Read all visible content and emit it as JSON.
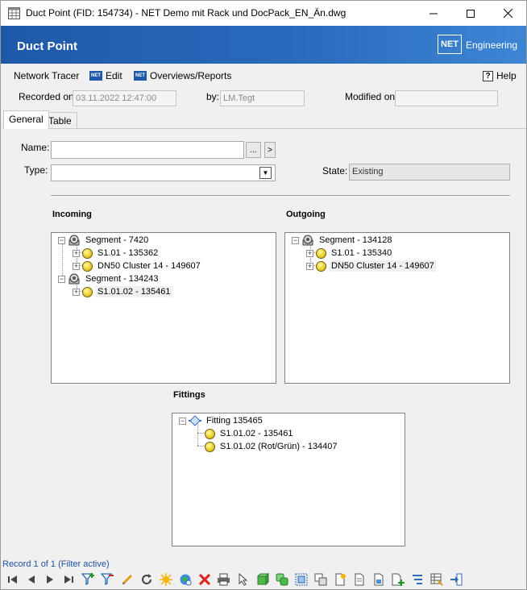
{
  "window": {
    "title": "Duct Point (FID: 154734) - NET Demo mit Rack und DocPack_EN_Än.dwg"
  },
  "banner": {
    "title": "Duct Point",
    "logo_text": "NET",
    "brand_text": "Engineering"
  },
  "menu": {
    "network_tracer": "Network Tracer",
    "edit": "Edit",
    "overviews": "Overviews/Reports",
    "help": "Help",
    "help_glyph": "?",
    "net_badge": "NET"
  },
  "record": {
    "recorded_on_label": "Recorded on:",
    "recorded_on_value": "03.11.2022 12:47:00",
    "by_label": "by:",
    "by_value": "LM.Tegt",
    "modified_on_label": "Modified on:",
    "modified_on_value": ""
  },
  "tabs": {
    "general": "General",
    "table": "Table"
  },
  "form": {
    "name_label": "Name:",
    "name_value": "",
    "ellipsis_button": "...",
    "arrow_button": ">",
    "type_label": "Type:",
    "type_value": "",
    "dropdown_glyph": "▼",
    "state_label": "State:",
    "state_value": "Existing"
  },
  "incoming": {
    "title": "Incoming",
    "segments": [
      {
        "label": "Segment - 7420",
        "children": [
          "S1.01 - 135362",
          "DN50 Cluster 14 - 149607"
        ]
      },
      {
        "label": "Segment - 134243",
        "children": [
          "S1.01.02 - 135461"
        ]
      }
    ]
  },
  "outgoing": {
    "title": "Outgoing",
    "segments": [
      {
        "label": "Segment - 134128",
        "children": [
          "S1.01 - 135340",
          "DN50 Cluster 14 - 149607"
        ]
      }
    ]
  },
  "fittings": {
    "title": "Fittings",
    "items": [
      {
        "label": "Fitting 135465",
        "children": [
          "S1.01.02 - 135461",
          "S1.01.02 (Rot/Grün) - 134407"
        ]
      }
    ]
  },
  "tree_glyphs": {
    "expanded": "−",
    "collapsed": "+"
  },
  "status": {
    "text": "Record 1 of 1 (Filter active)"
  },
  "toolbar": {
    "icons": [
      "first-record-icon",
      "previous-record-icon",
      "next-record-icon",
      "last-record-icon",
      "add-filter-icon",
      "remove-filter-icon",
      "pencil-icon",
      "refresh-icon",
      "new-record-icon",
      "zoom-to-icon",
      "delete-icon",
      "print-icon",
      "select-icon",
      "green-cube-icon",
      "copy-object-icon",
      "selection-box-icon",
      "duplicate-icon",
      "new-document-icon",
      "document-icon",
      "document-image-icon",
      "document-add-icon",
      "sort-icon",
      "table-edit-icon",
      "exit-icon"
    ]
  }
}
